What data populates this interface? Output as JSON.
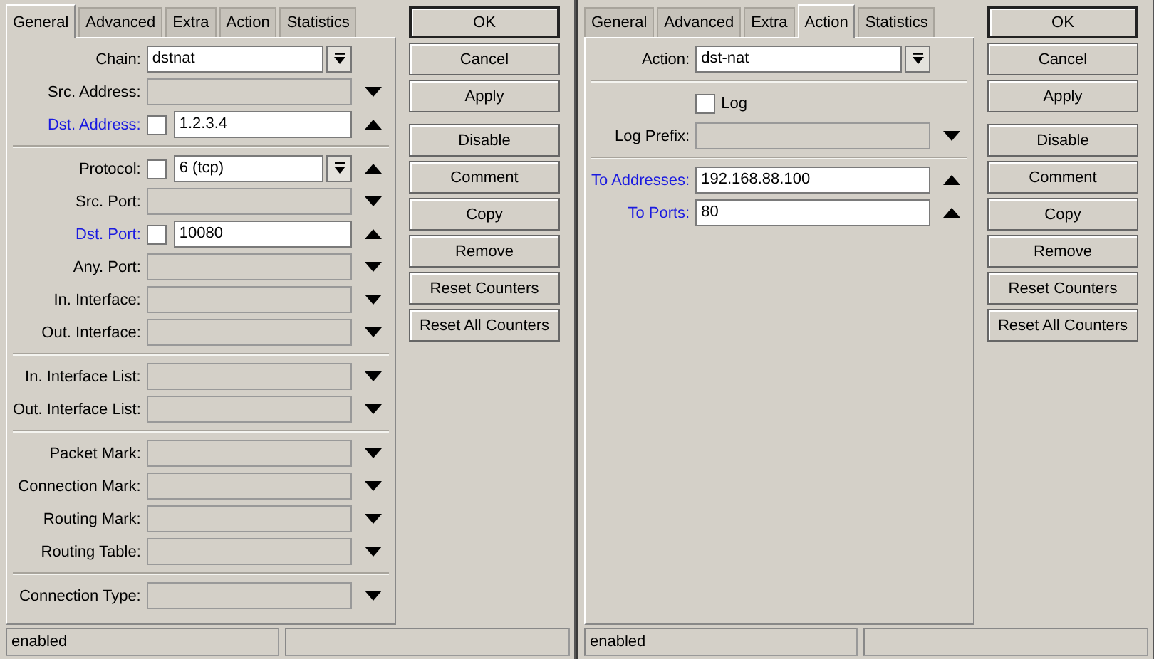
{
  "windows": [
    {
      "tabs": [
        {
          "label": "General",
          "selected": true
        },
        {
          "label": "Advanced",
          "selected": false
        },
        {
          "label": "Extra",
          "selected": false
        },
        {
          "label": "Action",
          "selected": false
        },
        {
          "label": "Statistics",
          "selected": false
        }
      ],
      "rows": [
        {
          "kind": "field",
          "label": "Chain:",
          "value": "dstnat",
          "enabled": true,
          "dropdown": true
        },
        {
          "kind": "field",
          "label": "Src. Address:",
          "enabled": false,
          "expanded": false
        },
        {
          "kind": "field",
          "label": "Dst. Address:",
          "highlighted": true,
          "negate": {
            "checked": false
          },
          "value": "1.2.3.4",
          "enabled": true,
          "expanded": true
        },
        {
          "kind": "separator"
        },
        {
          "kind": "field",
          "label": "Protocol:",
          "negate": {
            "checked": false
          },
          "value": "6 (tcp)",
          "enabled": true,
          "dropdown": true,
          "expanded": true
        },
        {
          "kind": "field",
          "label": "Src. Port:",
          "enabled": false,
          "expanded": false
        },
        {
          "kind": "field",
          "label": "Dst. Port:",
          "highlighted": true,
          "negate": {
            "checked": false
          },
          "value": "10080",
          "enabled": true,
          "expanded": true
        },
        {
          "kind": "field",
          "label": "Any. Port:",
          "enabled": false,
          "expanded": false
        },
        {
          "kind": "field",
          "label": "In. Interface:",
          "enabled": false,
          "expanded": false
        },
        {
          "kind": "field",
          "label": "Out. Interface:",
          "enabled": false,
          "expanded": false
        },
        {
          "kind": "separator"
        },
        {
          "kind": "field",
          "label": "In. Interface List:",
          "enabled": false,
          "expanded": false
        },
        {
          "kind": "field",
          "label": "Out. Interface List:",
          "enabled": false,
          "expanded": false
        },
        {
          "kind": "separator"
        },
        {
          "kind": "field",
          "label": "Packet Mark:",
          "enabled": false,
          "expanded": false
        },
        {
          "kind": "field",
          "label": "Connection Mark:",
          "enabled": false,
          "expanded": false
        },
        {
          "kind": "field",
          "label": "Routing Mark:",
          "enabled": false,
          "expanded": false
        },
        {
          "kind": "field",
          "label": "Routing Table:",
          "enabled": false,
          "expanded": false
        },
        {
          "kind": "separator"
        },
        {
          "kind": "field",
          "label": "Connection Type:",
          "enabled": false,
          "expanded": false
        }
      ],
      "buttons": [
        [
          {
            "label": "OK",
            "default": true
          },
          {
            "label": "Cancel",
            "default": false
          },
          {
            "label": "Apply",
            "default": false
          }
        ],
        [
          {
            "label": "Disable",
            "default": false
          },
          {
            "label": "Comment",
            "default": false
          },
          {
            "label": "Copy",
            "default": false
          },
          {
            "label": "Remove",
            "default": false
          },
          {
            "label": "Reset Counters",
            "default": false
          },
          {
            "label": "Reset All Counters",
            "default": false
          }
        ]
      ],
      "status": "enabled"
    },
    {
      "tabs": [
        {
          "label": "General",
          "selected": false
        },
        {
          "label": "Advanced",
          "selected": false
        },
        {
          "label": "Extra",
          "selected": false
        },
        {
          "label": "Action",
          "selected": true
        },
        {
          "label": "Statistics",
          "selected": false
        }
      ],
      "rows": [
        {
          "kind": "field",
          "label": "Action:",
          "value": "dst-nat",
          "enabled": true,
          "dropdown": true
        },
        {
          "kind": "separator"
        },
        {
          "kind": "check",
          "label": "Log",
          "checked": false
        },
        {
          "kind": "field",
          "label": "Log Prefix:",
          "enabled": false,
          "expanded": false
        },
        {
          "kind": "separator"
        },
        {
          "kind": "field",
          "label": "To Addresses:",
          "highlighted": true,
          "value": "192.168.88.100",
          "enabled": true,
          "expanded": true
        },
        {
          "kind": "field",
          "label": "To Ports:",
          "highlighted": true,
          "value": "80",
          "enabled": true,
          "expanded": true
        }
      ],
      "buttons": [
        [
          {
            "label": "OK",
            "default": true
          },
          {
            "label": "Cancel",
            "default": false
          },
          {
            "label": "Apply",
            "default": false
          }
        ],
        [
          {
            "label": "Disable",
            "default": false
          },
          {
            "label": "Comment",
            "default": false
          },
          {
            "label": "Copy",
            "default": false
          },
          {
            "label": "Remove",
            "default": false
          },
          {
            "label": "Reset Counters",
            "default": false
          },
          {
            "label": "Reset All Counters",
            "default": false
          }
        ]
      ],
      "status": "enabled"
    }
  ]
}
